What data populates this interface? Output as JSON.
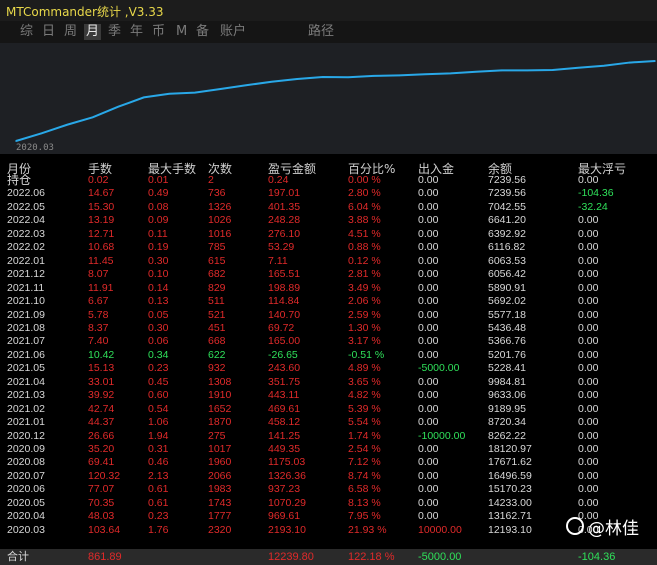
{
  "window": {
    "title": "MTCommander统计 ,V3.33"
  },
  "tabs": [
    {
      "label": "综"
    },
    {
      "label": "日"
    },
    {
      "label": "周"
    },
    {
      "label": "月"
    },
    {
      "label": "季"
    },
    {
      "label": "年"
    },
    {
      "label": "币"
    },
    {
      "label": "M"
    },
    {
      "label": "备"
    },
    {
      "label": "账户"
    }
  ],
  "tab_path": "路径",
  "active_tab": "月",
  "chart": {
    "x_start_label": "2020.03",
    "line_color": "#29a8e8",
    "points": [
      {
        "month": "2020.03",
        "balance": 12193.1
      },
      {
        "month": "2020.04",
        "balance": 13162.71
      },
      {
        "month": "2020.05",
        "balance": 14233.0
      },
      {
        "month": "2020.06",
        "balance": 15170.23
      },
      {
        "month": "2020.07",
        "balance": 16496.59
      },
      {
        "month": "2020.08",
        "balance": 17671.62
      },
      {
        "month": "2020.09",
        "balance": 18120.97
      },
      {
        "month": "2020.12",
        "balance": 18262.22
      },
      {
        "month": "2021.01",
        "balance": 18720.34
      },
      {
        "month": "2021.02",
        "balance": 19189.95
      },
      {
        "month": "2021.03",
        "balance": 19633.06
      },
      {
        "month": "2021.04",
        "balance": 19984.81
      },
      {
        "month": "2021.05",
        "balance": 20228.41
      },
      {
        "month": "2021.06",
        "balance": 20201.76
      },
      {
        "month": "2021.07",
        "balance": 20366.74
      },
      {
        "month": "2021.08",
        "balance": 20436.48
      },
      {
        "month": "2021.09",
        "balance": 20577.18
      },
      {
        "month": "2021.10",
        "balance": 20692.02
      },
      {
        "month": "2021.11",
        "balance": 20890.91
      },
      {
        "month": "2021.12",
        "balance": 21056.42
      },
      {
        "month": "2022.01",
        "balance": 21063.53
      },
      {
        "month": "2022.02",
        "balance": 21116.82
      },
      {
        "month": "2022.03",
        "balance": 21392.97
      },
      {
        "month": "2022.04",
        "balance": 21641.2
      },
      {
        "month": "2022.05",
        "balance": 22042.55
      },
      {
        "month": "2022.06",
        "balance": 22239.56
      }
    ]
  },
  "table": {
    "headers": [
      "月份",
      "手数",
      "最大手数",
      "次数",
      "盈亏金额",
      "百分比%",
      "出入金",
      "余额",
      "最大浮亏"
    ],
    "rows": [
      {
        "c": [
          "持仓",
          "0.02",
          "0.01",
          "2",
          "0.24",
          "0.00 %",
          "0.00",
          "7239.56",
          "0.00"
        ],
        "color": [
          "white",
          "red",
          "red",
          "red",
          "red",
          "red",
          "white",
          "white",
          "white"
        ]
      },
      {
        "c": [
          "2022.06",
          "14.67",
          "0.49",
          "736",
          "197.01",
          "2.80 %",
          "0.00",
          "7239.56",
          "-104.36"
        ],
        "color": [
          "white",
          "red",
          "red",
          "red",
          "red",
          "red",
          "white",
          "white",
          "green"
        ]
      },
      {
        "c": [
          "2022.05",
          "15.30",
          "0.08",
          "1326",
          "401.35",
          "6.04 %",
          "0.00",
          "7042.55",
          "-32.24"
        ],
        "color": [
          "white",
          "red",
          "red",
          "red",
          "red",
          "red",
          "white",
          "white",
          "green"
        ]
      },
      {
        "c": [
          "2022.04",
          "13.19",
          "0.09",
          "1026",
          "248.28",
          "3.88 %",
          "0.00",
          "6641.20",
          "0.00"
        ],
        "color": [
          "white",
          "red",
          "red",
          "red",
          "red",
          "red",
          "white",
          "white",
          "white"
        ]
      },
      {
        "c": [
          "2022.03",
          "12.71",
          "0.11",
          "1016",
          "276.10",
          "4.51 %",
          "0.00",
          "6392.92",
          "0.00"
        ],
        "color": [
          "white",
          "red",
          "red",
          "red",
          "red",
          "red",
          "white",
          "white",
          "white"
        ]
      },
      {
        "c": [
          "2022.02",
          "10.68",
          "0.19",
          "785",
          "53.29",
          "0.88 %",
          "0.00",
          "6116.82",
          "0.00"
        ],
        "color": [
          "white",
          "red",
          "red",
          "red",
          "red",
          "red",
          "white",
          "white",
          "white"
        ]
      },
      {
        "c": [
          "2022.01",
          "11.45",
          "0.30",
          "615",
          "7.11",
          "0.12 %",
          "0.00",
          "6063.53",
          "0.00"
        ],
        "color": [
          "white",
          "red",
          "red",
          "red",
          "red",
          "red",
          "white",
          "white",
          "white"
        ]
      },
      {
        "c": [
          "2021.12",
          "8.07",
          "0.10",
          "682",
          "165.51",
          "2.81 %",
          "0.00",
          "6056.42",
          "0.00"
        ],
        "color": [
          "white",
          "red",
          "red",
          "red",
          "red",
          "red",
          "white",
          "white",
          "white"
        ]
      },
      {
        "c": [
          "2021.11",
          "11.91",
          "0.14",
          "829",
          "198.89",
          "3.49 %",
          "0.00",
          "5890.91",
          "0.00"
        ],
        "color": [
          "white",
          "red",
          "red",
          "red",
          "red",
          "red",
          "white",
          "white",
          "white"
        ]
      },
      {
        "c": [
          "2021.10",
          "6.67",
          "0.13",
          "511",
          "114.84",
          "2.06 %",
          "0.00",
          "5692.02",
          "0.00"
        ],
        "color": [
          "white",
          "red",
          "red",
          "red",
          "red",
          "red",
          "white",
          "white",
          "white"
        ]
      },
      {
        "c": [
          "2021.09",
          "5.78",
          "0.05",
          "521",
          "140.70",
          "2.59 %",
          "0.00",
          "5577.18",
          "0.00"
        ],
        "color": [
          "white",
          "red",
          "red",
          "red",
          "red",
          "red",
          "white",
          "white",
          "white"
        ]
      },
      {
        "c": [
          "2021.08",
          "8.37",
          "0.30",
          "451",
          "69.72",
          "1.30 %",
          "0.00",
          "5436.48",
          "0.00"
        ],
        "color": [
          "white",
          "red",
          "red",
          "red",
          "red",
          "red",
          "white",
          "white",
          "white"
        ]
      },
      {
        "c": [
          "2021.07",
          "7.40",
          "0.06",
          "668",
          "165.00",
          "3.17 %",
          "0.00",
          "5366.76",
          "0.00"
        ],
        "color": [
          "white",
          "red",
          "red",
          "red",
          "red",
          "red",
          "white",
          "white",
          "white"
        ]
      },
      {
        "c": [
          "2021.06",
          "10.42",
          "0.34",
          "622",
          "-26.65",
          "-0.51 %",
          "0.00",
          "5201.76",
          "0.00"
        ],
        "color": [
          "white",
          "green",
          "green",
          "green",
          "green",
          "green",
          "white",
          "white",
          "white"
        ]
      },
      {
        "c": [
          "2021.05",
          "15.13",
          "0.23",
          "932",
          "243.60",
          "4.89 %",
          "-5000.00",
          "5228.41",
          "0.00"
        ],
        "color": [
          "white",
          "red",
          "red",
          "red",
          "red",
          "red",
          "green",
          "white",
          "white"
        ]
      },
      {
        "c": [
          "2021.04",
          "33.01",
          "0.45",
          "1308",
          "351.75",
          "3.65 %",
          "0.00",
          "9984.81",
          "0.00"
        ],
        "color": [
          "white",
          "red",
          "red",
          "red",
          "red",
          "red",
          "white",
          "white",
          "white"
        ]
      },
      {
        "c": [
          "2021.03",
          "39.92",
          "0.60",
          "1910",
          "443.11",
          "4.82 %",
          "0.00",
          "9633.06",
          "0.00"
        ],
        "color": [
          "white",
          "red",
          "red",
          "red",
          "red",
          "red",
          "white",
          "white",
          "white"
        ]
      },
      {
        "c": [
          "2021.02",
          "42.74",
          "0.54",
          "1652",
          "469.61",
          "5.39 %",
          "0.00",
          "9189.95",
          "0.00"
        ],
        "color": [
          "white",
          "red",
          "red",
          "red",
          "red",
          "red",
          "white",
          "white",
          "white"
        ]
      },
      {
        "c": [
          "2021.01",
          "44.37",
          "1.06",
          "1870",
          "458.12",
          "5.54 %",
          "0.00",
          "8720.34",
          "0.00"
        ],
        "color": [
          "white",
          "red",
          "red",
          "red",
          "red",
          "red",
          "white",
          "white",
          "white"
        ]
      },
      {
        "c": [
          "2020.12",
          "26.66",
          "1.94",
          "275",
          "141.25",
          "1.74 %",
          "-10000.00",
          "8262.22",
          "0.00"
        ],
        "color": [
          "white",
          "red",
          "red",
          "red",
          "red",
          "red",
          "green",
          "white",
          "white"
        ]
      },
      {
        "c": [
          "2020.09",
          "35.20",
          "0.31",
          "1017",
          "449.35",
          "2.54 %",
          "0.00",
          "18120.97",
          "0.00"
        ],
        "color": [
          "white",
          "red",
          "red",
          "red",
          "red",
          "red",
          "white",
          "white",
          "white"
        ]
      },
      {
        "c": [
          "2020.08",
          "69.41",
          "0.46",
          "1960",
          "1175.03",
          "7.12 %",
          "0.00",
          "17671.62",
          "0.00"
        ],
        "color": [
          "white",
          "red",
          "red",
          "red",
          "red",
          "red",
          "white",
          "white",
          "white"
        ]
      },
      {
        "c": [
          "2020.07",
          "120.32",
          "2.13",
          "2066",
          "1326.36",
          "8.74 %",
          "0.00",
          "16496.59",
          "0.00"
        ],
        "color": [
          "white",
          "red",
          "red",
          "red",
          "red",
          "red",
          "white",
          "white",
          "white"
        ]
      },
      {
        "c": [
          "2020.06",
          "77.07",
          "0.61",
          "1983",
          "937.23",
          "6.58 %",
          "0.00",
          "15170.23",
          "0.00"
        ],
        "color": [
          "white",
          "red",
          "red",
          "red",
          "red",
          "red",
          "white",
          "white",
          "white"
        ]
      },
      {
        "c": [
          "2020.05",
          "70.35",
          "0.61",
          "1743",
          "1070.29",
          "8.13 %",
          "0.00",
          "14233.00",
          "0.00"
        ],
        "color": [
          "white",
          "red",
          "red",
          "red",
          "red",
          "red",
          "white",
          "white",
          "white"
        ]
      },
      {
        "c": [
          "2020.04",
          "48.03",
          "0.23",
          "1777",
          "969.61",
          "7.95 %",
          "0.00",
          "13162.71",
          "0.00"
        ],
        "color": [
          "white",
          "red",
          "red",
          "red",
          "red",
          "red",
          "white",
          "white",
          "white"
        ]
      },
      {
        "c": [
          "2020.03",
          "103.64",
          "1.76",
          "2320",
          "2193.10",
          "21.93 %",
          "10000.00",
          "12193.10",
          "0.00"
        ],
        "color": [
          "white",
          "red",
          "red",
          "red",
          "red",
          "red",
          "red",
          "white",
          "white"
        ]
      }
    ],
    "total": {
      "c": [
        "合计",
        "861.89",
        "",
        "",
        "12239.80",
        "122.18 %",
        "-5000.00",
        "",
        "-104.36"
      ],
      "color": [
        "white",
        "red",
        "red",
        "red",
        "red",
        "red",
        "green",
        "white",
        "green"
      ]
    }
  },
  "watermark": "@林佳"
}
